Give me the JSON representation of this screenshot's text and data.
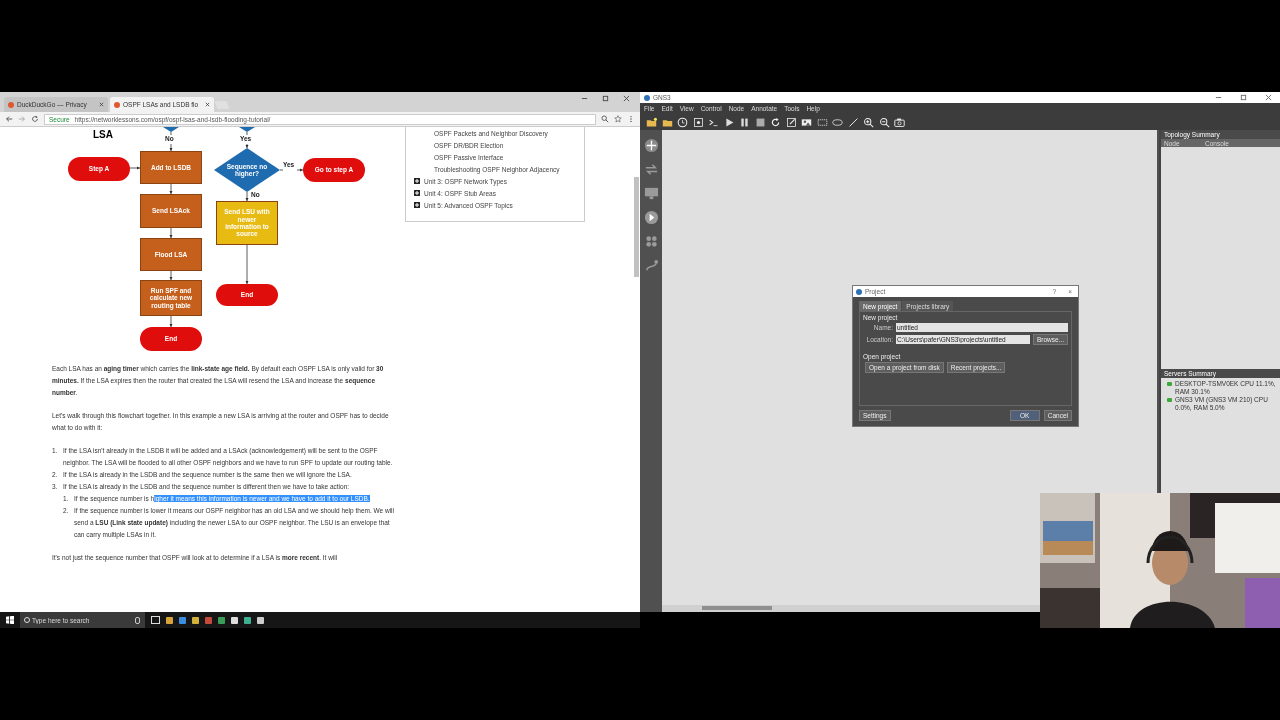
{
  "browser": {
    "tabs": [
      {
        "label": "DuckDuckGo — Privacy",
        "selected": false
      },
      {
        "label": "OSPF LSAs and LSDB flo",
        "selected": true
      }
    ],
    "secure_label": "Secure",
    "url": "https://networklessons.com/ospf/ospf-lsas-and-lsdb-flooding-tutorial/"
  },
  "article": {
    "heading": "LSA",
    "flowchart": {
      "nodes": [
        {
          "kind": "terminal",
          "text": "Step A",
          "color": "#e00d0d"
        },
        {
          "kind": "process",
          "text": "Add to LSDB",
          "color": "#c55f1c"
        },
        {
          "kind": "process",
          "text": "Send LSAck",
          "color": "#c55f1c"
        },
        {
          "kind": "process",
          "text": "Flood LSA",
          "color": "#c55f1c"
        },
        {
          "kind": "process",
          "text": "Run SPF and calculate new routing table",
          "color": "#c55f1c"
        },
        {
          "kind": "terminal",
          "text": "End",
          "color": "#e00d0d"
        },
        {
          "kind": "decision",
          "text": "Sequence no higher?",
          "color": "#1f6bb0"
        },
        {
          "kind": "terminal",
          "text": "Go to step A",
          "color": "#e00d0d"
        },
        {
          "kind": "process",
          "text": "Send LSU with newer information to source",
          "color": "#e8bb12"
        },
        {
          "kind": "terminal",
          "text": "End",
          "color": "#e00d0d"
        }
      ],
      "edge_labels": [
        "No",
        "Yes",
        "Yes",
        "No"
      ]
    },
    "paragraphs": [
      "Each LSA has an **aging timer** which carries the **link-state age field.** By default each OSPF LSA is only valid for **30 minutes.** If the LSA expires then the router that created the LSA will resend the LSA and increase the **sequence number**.",
      "Let's walk through this flowchart together. In this example a new LSA is arriving at the router and OSPF has to decide what to do with it:"
    ],
    "list": [
      {
        "number": "1.",
        "text": "If the LSA isn't already in the LSDB it will be added and a LSAck (acknowledgement) will be sent to the OSPF neighbor. The LSA will be flooded to all other OSPF neighbors and we have to run SPF to update our routing table."
      },
      {
        "number": "2.",
        "text": "If the LSA is already in the LSDB and the sequence number is the same then we will ignore the LSA."
      },
      {
        "number": "3.",
        "text": "If the LSA is already in the LSDB and the sequence number is different then we have to take action:",
        "children": [
          {
            "number": "1.",
            "text": "If the sequence number is h",
            "highlighted": "igher it means this information is newer and we have to add it to our LSDB."
          },
          {
            "number": "2.",
            "text": "If the sequence number is lower it means our OSPF neighbor has an old LSA and we should help them. We will send a **LSU (Link state update)** including the newer LSA to our OSPF neighbor. The LSU is an envelope that can carry multiple LSAs in it."
          }
        ]
      }
    ],
    "last_paragraph": "It's not just the sequence number that OSPF will look at to determine if a LSA is **more recent**. It will"
  },
  "sidebar": {
    "items": [
      {
        "kind": "lesson",
        "text": "OSPF Packets and Neighbor Discovery"
      },
      {
        "kind": "lesson",
        "text": "OSPF DR/BDR Election"
      },
      {
        "kind": "lesson",
        "text": "OSPF Passive Interface"
      },
      {
        "kind": "lesson",
        "text": "Troubleshooting OSPF Neighbor Adjacency"
      },
      {
        "kind": "unit",
        "text": "Unit 3: OSPF Network Types"
      },
      {
        "kind": "unit",
        "text": "Unit 4: OSPF Stub Areas"
      },
      {
        "kind": "unit",
        "text": "Unit 5: Advanced OSPF Topics"
      }
    ]
  },
  "gns3": {
    "title": "GNS3",
    "menu": [
      "File",
      "Edit",
      "View",
      "Control",
      "Node",
      "Annotate",
      "Tools",
      "Help"
    ],
    "topology_summary": {
      "title": "Topology Summary",
      "columns": [
        "Node",
        "Console"
      ]
    },
    "servers_summary": {
      "title": "Servers Summary",
      "servers": [
        "DESKTOP-TSMV0EK CPU 11.1%, RAM 30.1%",
        "GNS3 VM (GNS3 VM 210) CPU 0.0%, RAM 5.0%"
      ]
    },
    "dialog": {
      "title": "Project",
      "help": "?",
      "close": "×",
      "tabs": [
        {
          "label": "New project",
          "selected": true
        },
        {
          "label": "Projects library",
          "selected": false
        }
      ],
      "new_group": "New project",
      "name_label": "Name:",
      "name_value": "untitled",
      "location_label": "Location:",
      "location_value": "C:\\Users\\pafer\\GNS3\\projects\\untitled",
      "browse": "Browse...",
      "open_group": "Open project",
      "open_buttons": [
        "Open a project from disk",
        "Recent projects..."
      ],
      "settings": "Settings",
      "ok": "OK",
      "cancel": "Cancel"
    }
  },
  "taskbar": {
    "search": {
      "placeholder": "Type here to search"
    }
  }
}
